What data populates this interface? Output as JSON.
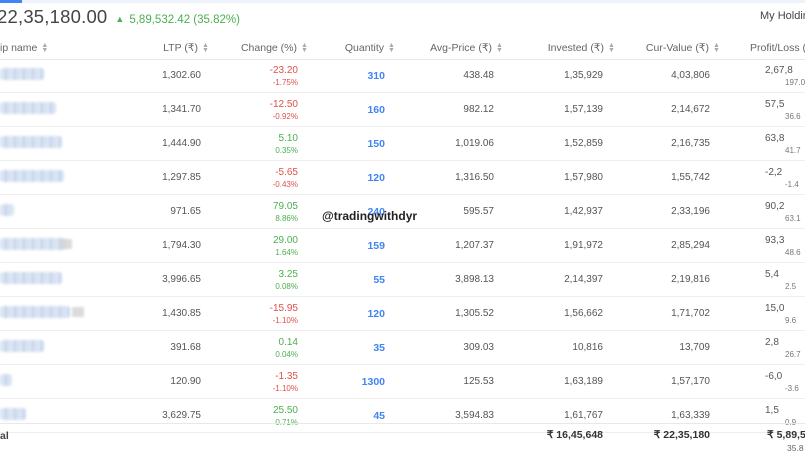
{
  "summary": {
    "current_value": "22,35,180.00",
    "pnl": "5,89,532.42 (35.82%)"
  },
  "my_holdings_label": "My Holdings",
  "columns": [
    "Trading symbol name",
    "LTP (₹)",
    "Change (%)",
    "Quantity",
    "Avg-Price (₹)",
    "Invested (₹)",
    "Cur-Value (₹)",
    "Profit/Loss (%)"
  ],
  "columns_visible": [
    "ip name",
    "LTP (₹)",
    "Change (%)",
    "Quantity",
    "Avg-Price (₹)",
    "Invested (₹)",
    "Cur-Value (₹)",
    "Profit/Loss (%"
  ],
  "rows": [
    {
      "ltp": "1,302.60",
      "chg": "-23.20",
      "chg_pct": "-1.75%",
      "dir": "neg",
      "qty": "310",
      "avg": "438.48",
      "inv": "1,35,929",
      "cur": "4,03,806",
      "pl": "2,67,8",
      "pl_pct": "197.0"
    },
    {
      "ltp": "1,341.70",
      "chg": "-12.50",
      "chg_pct": "-0.92%",
      "dir": "neg",
      "qty": "160",
      "avg": "982.12",
      "inv": "1,57,139",
      "cur": "2,14,672",
      "pl": "57,5",
      "pl_pct": "36.6"
    },
    {
      "ltp": "1,444.90",
      "chg": "5.10",
      "chg_pct": "0.35%",
      "dir": "pos",
      "qty": "150",
      "avg": "1,019.06",
      "inv": "1,52,859",
      "cur": "2,16,735",
      "pl": "63,8",
      "pl_pct": "41.7"
    },
    {
      "ltp": "1,297.85",
      "chg": "-5.65",
      "chg_pct": "-0.43%",
      "dir": "neg",
      "qty": "120",
      "avg": "1,316.50",
      "inv": "1,57,980",
      "cur": "1,55,742",
      "pl": "-2,2",
      "pl_pct": "-1.4"
    },
    {
      "ltp": "971.65",
      "chg": "79.05",
      "chg_pct": "8.86%",
      "dir": "pos",
      "qty": "240",
      "avg": "595.57",
      "inv": "1,42,937",
      "cur": "2,33,196",
      "pl": "90,2",
      "pl_pct": "63.1"
    },
    {
      "ltp": "1,794.30",
      "chg": "29.00",
      "chg_pct": "1.64%",
      "dir": "pos",
      "qty": "159",
      "avg": "1,207.37",
      "inv": "1,91,972",
      "cur": "2,85,294",
      "pl": "93,3",
      "pl_pct": "48.6"
    },
    {
      "ltp": "3,996.65",
      "chg": "3.25",
      "chg_pct": "0.08%",
      "dir": "pos",
      "qty": "55",
      "avg": "3,898.13",
      "inv": "2,14,397",
      "cur": "2,19,816",
      "pl": "5,4",
      "pl_pct": "2.5"
    },
    {
      "ltp": "1,430.85",
      "chg": "-15.95",
      "chg_pct": "-1.10%",
      "dir": "neg",
      "qty": "120",
      "avg": "1,305.52",
      "inv": "1,56,662",
      "cur": "1,71,702",
      "pl": "15,0",
      "pl_pct": "9.6"
    },
    {
      "ltp": "391.68",
      "chg": "0.14",
      "chg_pct": "0.04%",
      "dir": "pos",
      "qty": "35",
      "avg": "309.03",
      "inv": "10,816",
      "cur": "13,709",
      "pl": "2,8",
      "pl_pct": "26.7"
    },
    {
      "ltp": "120.90",
      "chg": "-1.35",
      "chg_pct": "-1.10%",
      "dir": "neg",
      "qty": "1300",
      "avg": "125.53",
      "inv": "1,63,189",
      "cur": "1,57,170",
      "pl": "-6,0",
      "pl_pct": "-3.6"
    },
    {
      "ltp": "3,629.75",
      "chg": "25.50",
      "chg_pct": "0.71%",
      "dir": "pos",
      "qty": "45",
      "avg": "3,594.83",
      "inv": "1,61,767",
      "cur": "1,63,339",
      "pl": "1,5",
      "pl_pct": "0.9"
    }
  ],
  "footer": {
    "label": "al",
    "invested": "₹ 16,45,648",
    "cur_value": "₹ 22,35,180",
    "pl": "₹ 5,89,5",
    "pl_pct": "35.8"
  },
  "watermark": "@tradingwithdyr",
  "colors": {
    "positive": "#4caf50",
    "negative": "#df514c",
    "quantity": "#4184f3"
  }
}
